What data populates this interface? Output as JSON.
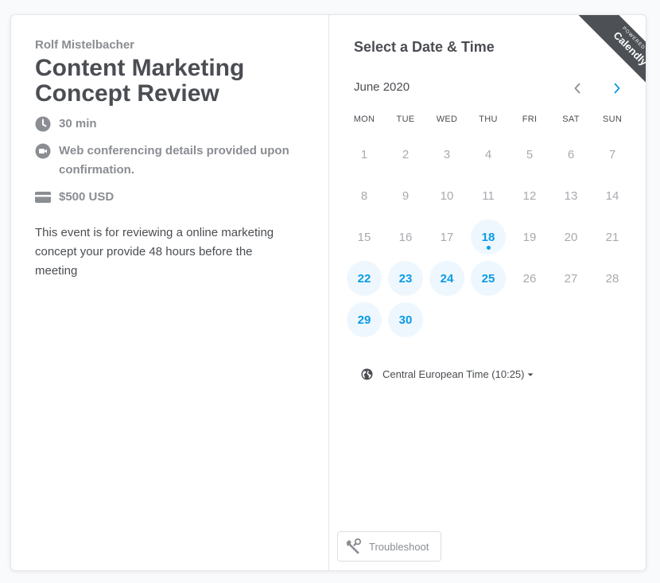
{
  "event": {
    "host": "Rolf Mistelbacher",
    "title": "Content Marketing Concept Review",
    "duration": "30 min",
    "location": "Web conferencing details provided upon confirmation.",
    "price": "$500 USD",
    "description": "This event is for reviewing a online marketing concept your provide 48 hours before the meeting"
  },
  "scheduler": {
    "heading": "Select a Date & Time",
    "month": "June 2020",
    "weekdays": [
      "MON",
      "TUE",
      "WED",
      "THU",
      "FRI",
      "SAT",
      "SUN"
    ],
    "days": [
      {
        "n": "1",
        "avail": false
      },
      {
        "n": "2",
        "avail": false
      },
      {
        "n": "3",
        "avail": false
      },
      {
        "n": "4",
        "avail": false
      },
      {
        "n": "5",
        "avail": false
      },
      {
        "n": "6",
        "avail": false
      },
      {
        "n": "7",
        "avail": false
      },
      {
        "n": "8",
        "avail": false
      },
      {
        "n": "9",
        "avail": false
      },
      {
        "n": "10",
        "avail": false
      },
      {
        "n": "11",
        "avail": false
      },
      {
        "n": "12",
        "avail": false
      },
      {
        "n": "13",
        "avail": false
      },
      {
        "n": "14",
        "avail": false
      },
      {
        "n": "15",
        "avail": false
      },
      {
        "n": "16",
        "avail": false
      },
      {
        "n": "17",
        "avail": false
      },
      {
        "n": "18",
        "avail": true,
        "today": true
      },
      {
        "n": "19",
        "avail": false
      },
      {
        "n": "20",
        "avail": false
      },
      {
        "n": "21",
        "avail": false
      },
      {
        "n": "22",
        "avail": true
      },
      {
        "n": "23",
        "avail": true
      },
      {
        "n": "24",
        "avail": true
      },
      {
        "n": "25",
        "avail": true
      },
      {
        "n": "26",
        "avail": false
      },
      {
        "n": "27",
        "avail": false
      },
      {
        "n": "28",
        "avail": false
      },
      {
        "n": "29",
        "avail": true
      },
      {
        "n": "30",
        "avail": true
      }
    ],
    "timezone": "Central European Time (10:25)",
    "troubleshoot": "Troubleshoot"
  },
  "ribbon": {
    "small": "POWERED BY",
    "big": "Calendly"
  },
  "colors": {
    "accent": "#0a9be5",
    "available_bg": "#eef7fe",
    "text_dark": "#4a4d52",
    "text_muted": "#8a8d92",
    "ribbon": "#4d5055"
  }
}
